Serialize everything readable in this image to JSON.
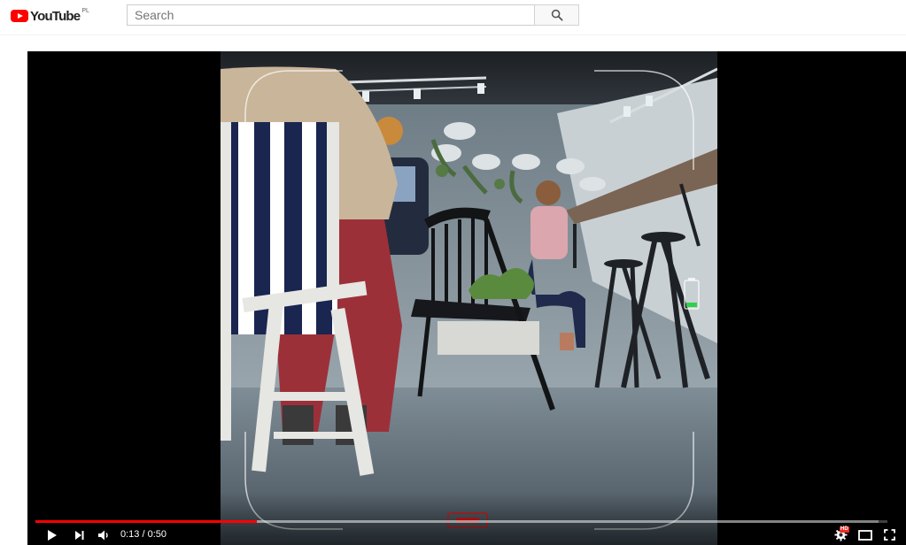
{
  "header": {
    "logo_text": "YouTube",
    "country_code": "PL",
    "search_placeholder": "Search"
  },
  "player": {
    "current_time": "0:13",
    "separator": " / ",
    "duration": "0:50",
    "progress_played": 0.26,
    "progress_loaded": 0.99,
    "settings_badge": "HD",
    "icons": [
      "play-icon",
      "next-icon",
      "volume-icon",
      "settings-icon",
      "theater-icon",
      "fullscreen-icon"
    ]
  },
  "colors": {
    "brand_red": "#ff0000",
    "player_bg": "#000000",
    "hd_badge": "#f12b24"
  }
}
